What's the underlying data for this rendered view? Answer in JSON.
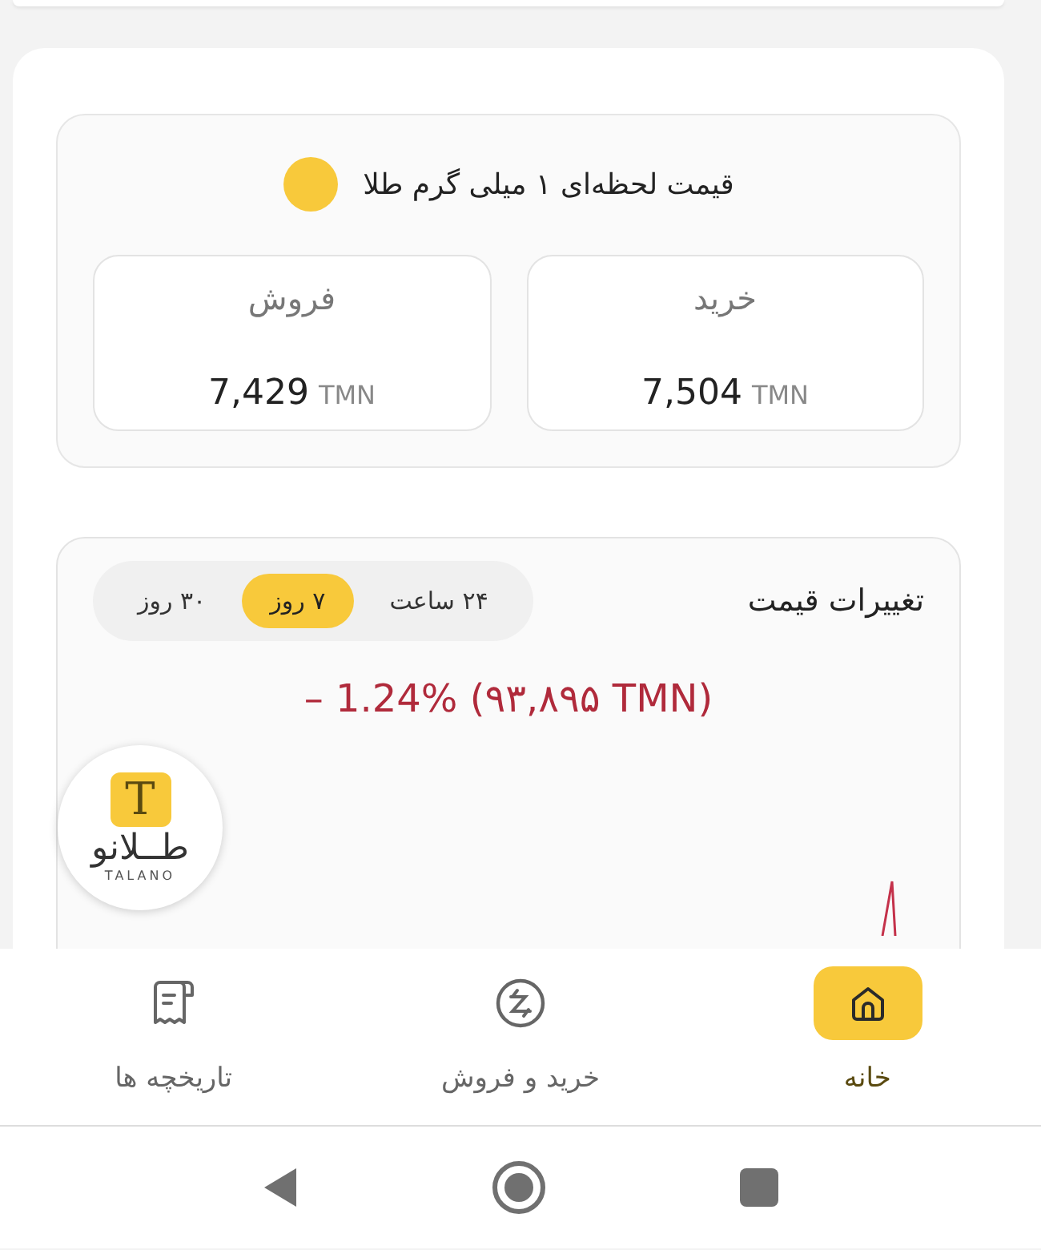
{
  "price_card": {
    "title": "قیمت لحظه‌ای ۱ میلی گرم طلا",
    "quotes": [
      {
        "label": "خرید",
        "value": "7,504",
        "unit": "TMN"
      },
      {
        "label": "فروش",
        "value": "7,429",
        "unit": "TMN"
      }
    ]
  },
  "changes_card": {
    "title": "تغییرات قیمت",
    "ranges": [
      {
        "label": "۲۴ ساعت",
        "selected": false
      },
      {
        "label": "۷ روز",
        "selected": true
      },
      {
        "label": "۳۰ روز",
        "selected": false
      }
    ],
    "change": "– 1.24% (۹۳,۸۹۵ TMN)"
  },
  "logo": {
    "letter": "T",
    "name": "طــلانو",
    "latin": "TALANO"
  },
  "bottom_nav": [
    {
      "label": "خانه",
      "selected": true
    },
    {
      "label": "خرید و فروش",
      "selected": false
    },
    {
      "label": "تاریخچه ها",
      "selected": false
    }
  ]
}
